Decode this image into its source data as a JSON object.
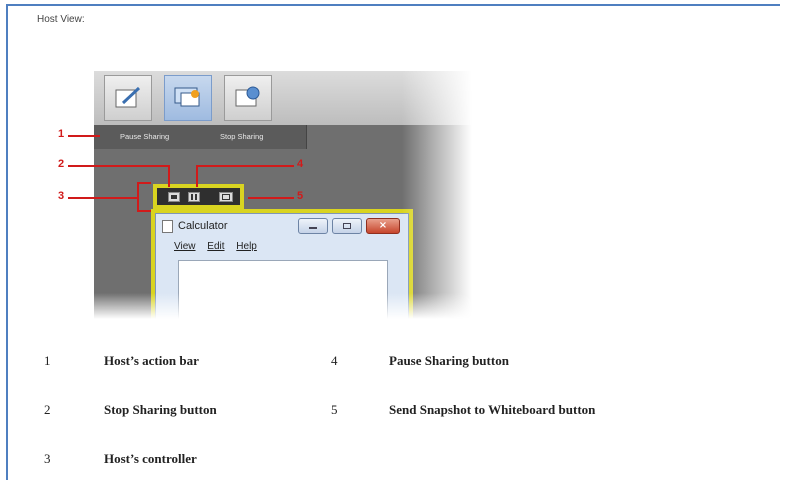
{
  "page": {
    "title": "Host View:"
  },
  "toolbar": {
    "buttons": [
      {
        "icon": "pencil-edit-icon"
      },
      {
        "icon": "share-desktop-icon"
      },
      {
        "icon": "web-share-icon"
      }
    ]
  },
  "action_bar": {
    "pause_label": "Pause Sharing",
    "stop_label": "Stop Sharing"
  },
  "controller": {
    "icons": [
      "stop-icon",
      "pause-icon",
      "snapshot-icon"
    ]
  },
  "calculator": {
    "title": "Calculator",
    "menu": [
      "View",
      "Edit",
      "Help"
    ]
  },
  "callouts": [
    "1",
    "2",
    "3",
    "4",
    "5"
  ],
  "legend": [
    {
      "num": "1",
      "text": "Host’s action bar"
    },
    {
      "num": "2",
      "text": "Stop Sharing button"
    },
    {
      "num": "3",
      "text": "Host’s controller"
    },
    {
      "num": "4",
      "text": "Pause Sharing button"
    },
    {
      "num": "5",
      "text": "Send Snapshot to Whiteboard button"
    }
  ],
  "colors": {
    "accent": "#d11a1a",
    "highlight": "#d9d420",
    "frame": "#4f7fc0"
  }
}
